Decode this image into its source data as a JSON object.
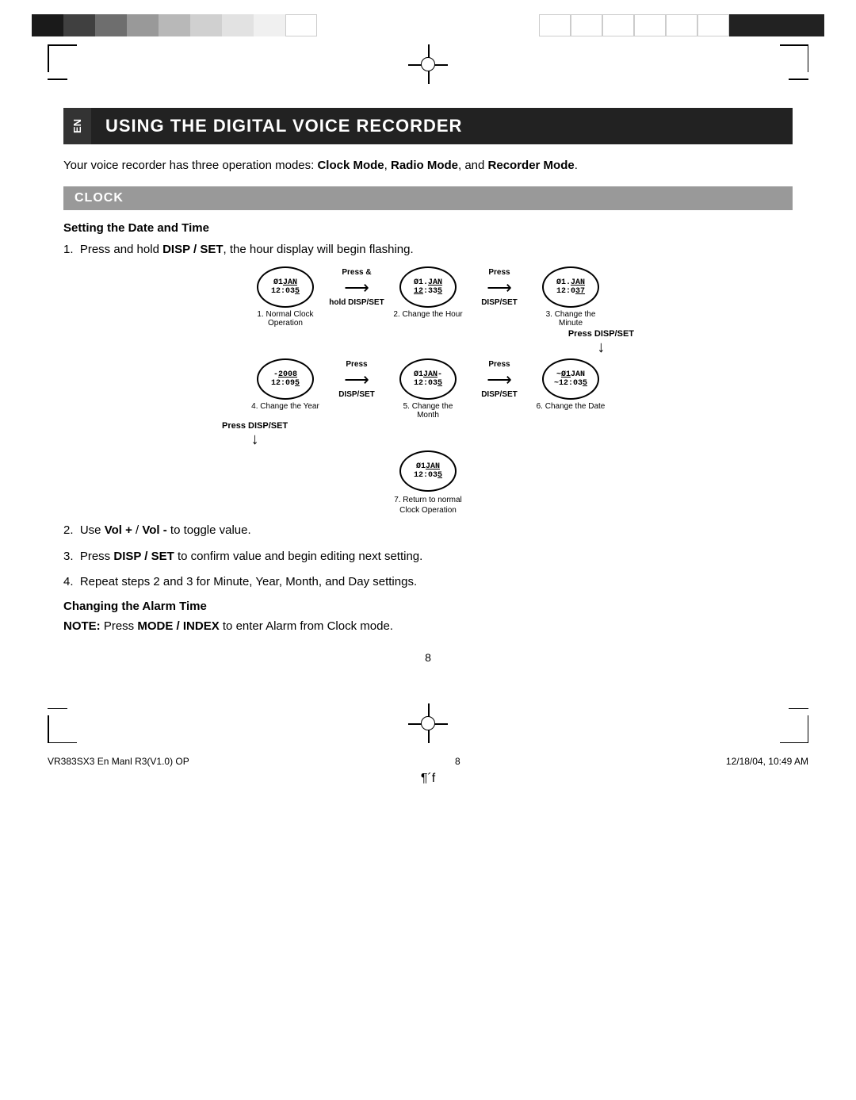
{
  "topBar": {
    "colorsLeft": [
      "#222222",
      "#555555",
      "#888888",
      "#aaaaaa",
      "#cccccc",
      "#dddddd",
      "#eeeeee",
      "#f5f5f5",
      "#ffffff"
    ],
    "colorsRight": [
      "#ffffff",
      "#ffffff",
      "#ffffff",
      "#ffffff",
      "#ffffff",
      "#ffffff",
      "#222222",
      "#222222",
      "#222222"
    ]
  },
  "title": {
    "enLabel": "EN",
    "heading": "USING THE DIGITAL VOICE RECORDER"
  },
  "intro": "Your voice recorder has three operation modes: Clock Mode, Radio Mode, and Recorder Mode.",
  "clock": {
    "sectionLabel": "CLOCK",
    "settingDateTimeHeading": "Setting the Date and Time",
    "step1": "Press and hold DISP / SET, the hour display will begin flashing.",
    "diagram": {
      "normalClock": "1. Normal Clock Operation",
      "changeHour": "2. Change the Hour",
      "changeMinute": "3. Change the Minute",
      "pressHoldDispSet": "Press &\nhold DISP/SET",
      "pressDispSet1": "Press\nDISP/SET",
      "pressDispSetMiddle": "Press DISP/SET",
      "pressDispSet2": "Press\nDISP/SET",
      "changeYear": "4. Change the Year",
      "changeMonth": "5. Change the Month",
      "changeDate": "6. Change the Date",
      "pressDispSetBottom": "Press DISP/SET",
      "returnNormal": "7. Return to normal\nClock Operation",
      "clock1Top": "Ø1JAN",
      "clock1Bot": "12:035",
      "clock2Top": "Ø1.JAN",
      "clock2Bot": "12:335",
      "clock3Top": "Ø1.JAN",
      "clock3Bot": "12:037",
      "clock4Top": "-2008",
      "clock4Bot": "12:095",
      "clock5Top": "Ø1JAN-",
      "clock5Bot": "12:035",
      "clock6Top": "~Ø1JAN",
      "clock6Bot": "~12:035",
      "clock7Top": "Ø1JAN",
      "clock7Bot": "12:035"
    },
    "step2": "Use Vol + / Vol - to toggle value.",
    "step3": "Press DISP / SET to confirm value and begin editing next setting.",
    "step4": "Repeat steps 2 and 3 for Minute, Year, Month, and Day settings.",
    "changingAlarmHeading": "Changing the Alarm Time",
    "noteText": "NOTE: Press MODE / INDEX to enter Alarm from Clock mode."
  },
  "pageNumber": "8",
  "footer": {
    "left": "VR383SX3 En Manl R3(V1.0) OP",
    "center": "8",
    "right": "12/18/04, 10:49 AM"
  },
  "bottomSymbol": "¶´f"
}
